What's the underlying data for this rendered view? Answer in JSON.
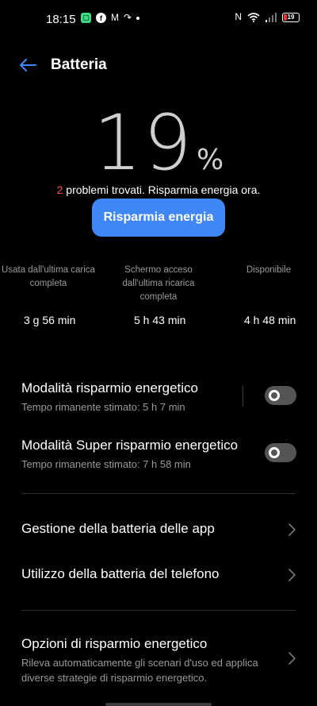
{
  "status_bar": {
    "time": "18:15",
    "battery_level": "19"
  },
  "header": {
    "title": "Batteria"
  },
  "battery": {
    "percent": "19",
    "percent_sign": "%",
    "problems_count": "2",
    "problems_text": " problemi trovati. Risparmia energia ora.",
    "save_button_label": "Risparmia energia"
  },
  "stats": [
    {
      "label": "Usata dall'ultima carica completa",
      "value": "3 g 56 min"
    },
    {
      "label": "Schermo acceso dall'ultima ricarica completa",
      "value": "5 h 43 min"
    },
    {
      "label": "Disponibile",
      "value": "4 h 48 min"
    }
  ],
  "power_saving": {
    "title": "Modalità risparmio energetico",
    "subtitle": "Tempo rimanente stimato:  5 h 7 min",
    "enabled": false
  },
  "super_power_saving": {
    "title": "Modalità Super risparmio energetico",
    "subtitle": "Tempo rimanente stimato:  7 h 58 min",
    "enabled": false
  },
  "menu": {
    "app_battery": "Gestione della batteria delle app",
    "phone_battery": "Utilizzo della batteria del telefono",
    "options_title": "Opzioni di risparmio energetico",
    "options_subtitle": "Rileva automaticamente gli scenari d'uso ed applica diverse strategie di risparmio energetico."
  },
  "colors": {
    "accent": "#3f87f6",
    "warning": "#ff4b4b",
    "background": "#000000"
  }
}
